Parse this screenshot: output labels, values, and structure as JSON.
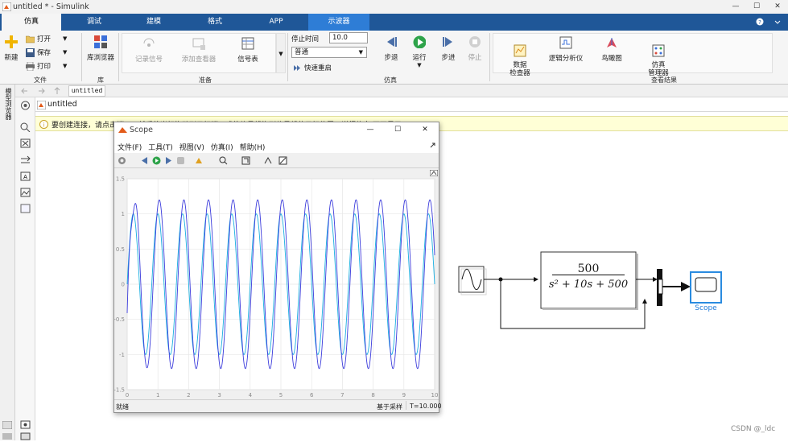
{
  "window": {
    "title": "untitled * - Simulink",
    "controls": [
      "—",
      "☐",
      "✕"
    ]
  },
  "ribbon_tabs": [
    {
      "label": "仿真"
    },
    {
      "label": "调试"
    },
    {
      "label": "建模"
    },
    {
      "label": "格式"
    },
    {
      "label": "APP"
    },
    {
      "label": "示波器"
    }
  ],
  "file_group": {
    "new_label": "新建",
    "open_label": "打开",
    "save_label": "保存",
    "print_label": "打印",
    "group_label": "文件"
  },
  "library_group": {
    "browser_label": "库浏览器",
    "group_label": "库"
  },
  "prepare_group": {
    "log_signals": "记录信号",
    "add_viewer": "添加查看器",
    "signal_table": "信号表",
    "group_label": "准备"
  },
  "simulate_group": {
    "stop_time_label": "停止时间",
    "stop_time_value": "10.0",
    "mode_value": "普通",
    "fast_restart": "快速重启",
    "step_back": "步退",
    "run": "运行",
    "step_forward": "步进",
    "stop": "停止",
    "group_label": "仿真"
  },
  "results_group": {
    "data_inspector": "数据\n检查器",
    "logic_analyzer": "逻辑分析仪",
    "bird_eye": "鸟瞰图",
    "sim_manager": "仿真\n管理器",
    "group_label": "查看结果"
  },
  "nav": {
    "tab_label": "untitled"
  },
  "browser_strip_label": "模型浏览器",
  "breadcrumb": {
    "model": "untitled"
  },
  "notice": {
    "text": "要创建连接，请点击端口，然后将光标拖动到目标端口或将信号线拖到信号线的目标位置。详细信息   不再显示"
  },
  "scope": {
    "title": "Scope",
    "menu": [
      "文件(F)",
      "工具(T)",
      "视图(V)",
      "仿真(I)",
      "帮助(H)"
    ],
    "status_left": "就绪",
    "status_mid": "基于采样",
    "status_right": "T=10.000"
  },
  "diagram": {
    "transfer_fn": {
      "numerator": "500",
      "denominator": "s² + 10s + 500"
    },
    "scope_label": "Scope"
  },
  "watermark": "CSDN @_ldc",
  "colors": {
    "ribbon_blue": "#1f5798",
    "scope_tab": "#2e7dd6",
    "signal_blue": "#3c3cdc",
    "signal_cyan": "#19aee0",
    "scope_label": "#1f7ad8"
  },
  "chart_data": {
    "type": "line",
    "x_ticks": [
      "0",
      "1",
      "2",
      "3",
      "4",
      "5",
      "6",
      "7",
      "8",
      "9",
      "10"
    ],
    "y_ticks": [
      "1.5",
      "1",
      "0.5",
      "0",
      "-0.5",
      "-1",
      "-1.5"
    ],
    "xlim": [
      0,
      10
    ],
    "ylim": [
      -1.5,
      1.5
    ],
    "grid": true,
    "series": [
      {
        "color": "#19aee0",
        "function": "sin(2*pi*1.25*t)",
        "amplitude": 1.0,
        "frequency_hz": 1.25
      },
      {
        "color": "#3c3cdc",
        "function": "H(s) response",
        "amplitude": 1.2,
        "frequency_hz": 1.25
      }
    ]
  }
}
